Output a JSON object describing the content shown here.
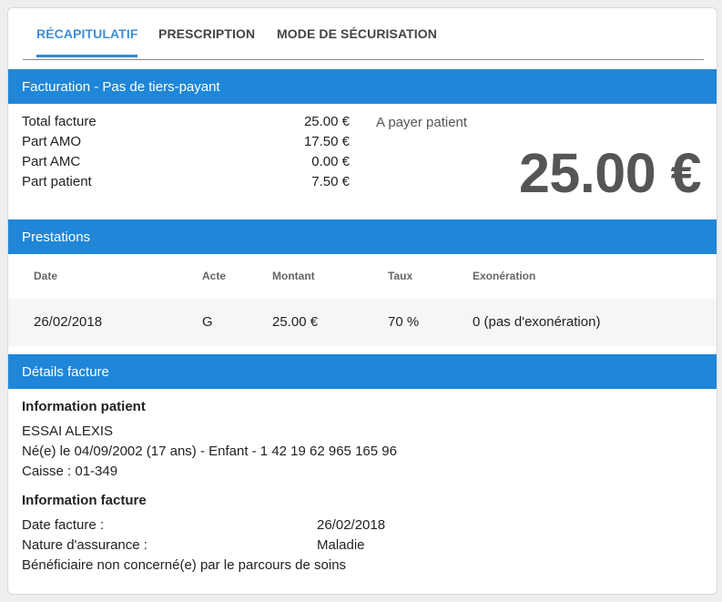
{
  "tabs": [
    {
      "label": "RÉCAPITULATIF",
      "active": true
    },
    {
      "label": "PRESCRIPTION",
      "active": false
    },
    {
      "label": "MODE DE SÉCURISATION",
      "active": false
    }
  ],
  "billing": {
    "title": "Facturation - Pas de tiers-payant",
    "rows": [
      {
        "label": "Total facture",
        "value": "25.00 €"
      },
      {
        "label": "Part AMO",
        "value": "17.50 €"
      },
      {
        "label": "Part AMC",
        "value": "0.00 €"
      },
      {
        "label": "Part patient",
        "value": "7.50 €"
      }
    ],
    "pay_label": "A payer patient",
    "pay_amount": "25.00 €"
  },
  "prestations": {
    "title": "Prestations",
    "headers": [
      "Date",
      "Acte",
      "Montant",
      "Taux",
      "Exonération"
    ],
    "rows": [
      [
        "26/02/2018",
        "G",
        "25.00 €",
        "70 %",
        "0 (pas d'exonération)"
      ]
    ]
  },
  "details": {
    "title": "Détails facture",
    "patient_heading": "Information patient",
    "patient_name": "ESSAI ALEXIS",
    "patient_birth": "Né(e) le 04/09/2002 (17 ans) - Enfant - 1 42 19 62 965 165 96",
    "patient_caisse": "Caisse : 01-349",
    "invoice_heading": "Information facture",
    "invoice_date_label": "Date facture :",
    "invoice_date_value": "26/02/2018",
    "insurance_label": "Nature d'assurance :",
    "insurance_value": "Maladie",
    "care_path": "Bénéficiaire non concerné(e) par le parcours de soins"
  },
  "colors": {
    "accent": "#1f86d8",
    "tab_active": "#3b8fd6"
  }
}
